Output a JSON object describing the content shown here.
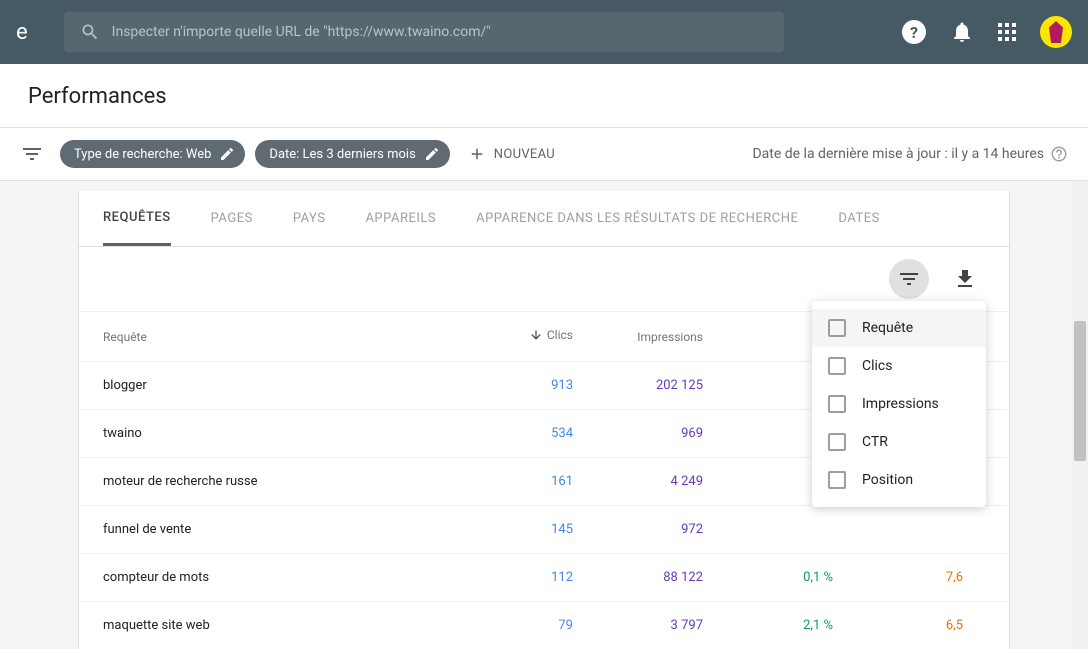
{
  "topbar": {
    "search_placeholder": "Inspecter n'importe quelle URL de \"https://www.twaino.com/\""
  },
  "page_title": "Performances",
  "filters": {
    "chip_type": "Type de recherche: Web",
    "chip_date": "Date: Les 3 derniers mois",
    "new_label": "NOUVEAU",
    "update_label": "Date de la dernière mise à jour : il y a 14 heures"
  },
  "tabs": {
    "requetes": "REQUÊTES",
    "pages": "PAGES",
    "pays": "PAYS",
    "appareils": "APPAREILS",
    "apparence": "APPARENCE DANS LES RÉSULTATS DE RECHERCHE",
    "dates": "DATES"
  },
  "table": {
    "col_query": "Requête",
    "col_clics": "Clics",
    "col_impr": "Impressions",
    "rows": [
      {
        "q": "blogger",
        "c": "913",
        "i": "202 125",
        "ctr": "",
        "p": ""
      },
      {
        "q": "twaino",
        "c": "534",
        "i": "969",
        "ctr": "",
        "p": ""
      },
      {
        "q": "moteur de recherche russe",
        "c": "161",
        "i": "4 249",
        "ctr": "",
        "p": ""
      },
      {
        "q": "funnel de vente",
        "c": "145",
        "i": "972",
        "ctr": "",
        "p": ""
      },
      {
        "q": "compteur de mots",
        "c": "112",
        "i": "88 122",
        "ctr": "0,1 %",
        "p": "7,6"
      },
      {
        "q": "maquette site web",
        "c": "79",
        "i": "3 797",
        "ctr": "2,1 %",
        "p": "6,5"
      }
    ]
  },
  "filter_menu": {
    "requete": "Requête",
    "clics": "Clics",
    "impressions": "Impressions",
    "ctr": "CTR",
    "position": "Position"
  }
}
